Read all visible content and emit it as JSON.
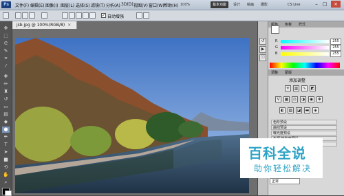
{
  "app": {
    "logo": "Ps"
  },
  "menus": [
    "文件(F)",
    "编辑(E)",
    "图像(I)",
    "图层(L)",
    "选择(S)",
    "滤镜(T)",
    "分析(A)",
    "3D(D)",
    "视图(V)",
    "窗口(W)",
    "帮助(H)"
  ],
  "topbar": {
    "zoom": "100%",
    "workspaces": [
      "基本功能",
      "设计",
      "绘画",
      "摄影"
    ],
    "cs_live": "CS Live"
  },
  "options": {
    "auto_enhance_label": "自动增强",
    "auto_enhance_checked": "✓"
  },
  "document": {
    "tab_title": "jsb.jpg @ 100%(RGB/8)",
    "close": "×"
  },
  "color_panel": {
    "tabs": [
      "颜色",
      "色板",
      "样式"
    ],
    "r_label": "R",
    "r_value": "255",
    "g_label": "G",
    "g_value": "255",
    "b_label": "B",
    "b_value": "255"
  },
  "adjust_panel": {
    "tabs": [
      "调整",
      "蒙版"
    ],
    "title": "添加调整",
    "presets": [
      "色阶预设",
      "曲线预设",
      "曝光度预设",
      "色相/饱和度预设",
      "黑白预设"
    ]
  },
  "layers_panel": {
    "blend_mode": "正常"
  },
  "watermark": {
    "line1": "百科全说",
    "line2": "助你轻松解决"
  },
  "colors": {
    "accent": "#3a3a3a",
    "watermark": "#2fa3c6",
    "close": "#c74b3c"
  }
}
